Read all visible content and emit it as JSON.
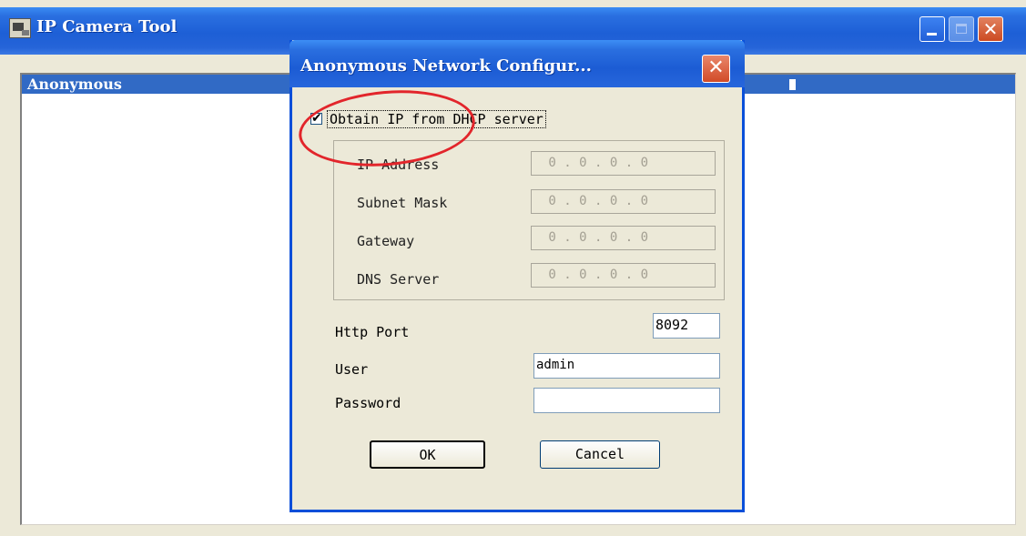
{
  "main_window": {
    "title": "IP Camera Tool",
    "controls": {
      "close_glyph": "✕"
    }
  },
  "camera_list": {
    "selected_item": "Anonymous"
  },
  "dialog": {
    "title": "Anonymous Network Configur...",
    "close_glyph": "✕",
    "dhcp": {
      "label": "Obtain IP from DHCP server",
      "checked": true,
      "check_glyph": "✔"
    },
    "ip_address": {
      "label": "IP Address",
      "value": " 0 . 0 . 0 . 0"
    },
    "subnet_mask": {
      "label": "Subnet Mask",
      "value": " 0 . 0 . 0 . 0"
    },
    "gateway": {
      "label": "Gateway",
      "value": " 0 . 0 . 0 . 0"
    },
    "dns_server": {
      "label": "DNS Server",
      "value": " 0 . 0 . 0 . 0"
    },
    "http_port": {
      "label": "Http Port",
      "value": "8092"
    },
    "user": {
      "label": "User",
      "value": "admin"
    },
    "password": {
      "label": "Password",
      "value": ""
    },
    "ok_label": "OK",
    "cancel_label": "Cancel"
  },
  "colors": {
    "titlebar_blue": "#1d5fd6",
    "selection_blue": "#316ac5",
    "window_face": "#ece9d8",
    "annotation_red": "#e2252b"
  }
}
